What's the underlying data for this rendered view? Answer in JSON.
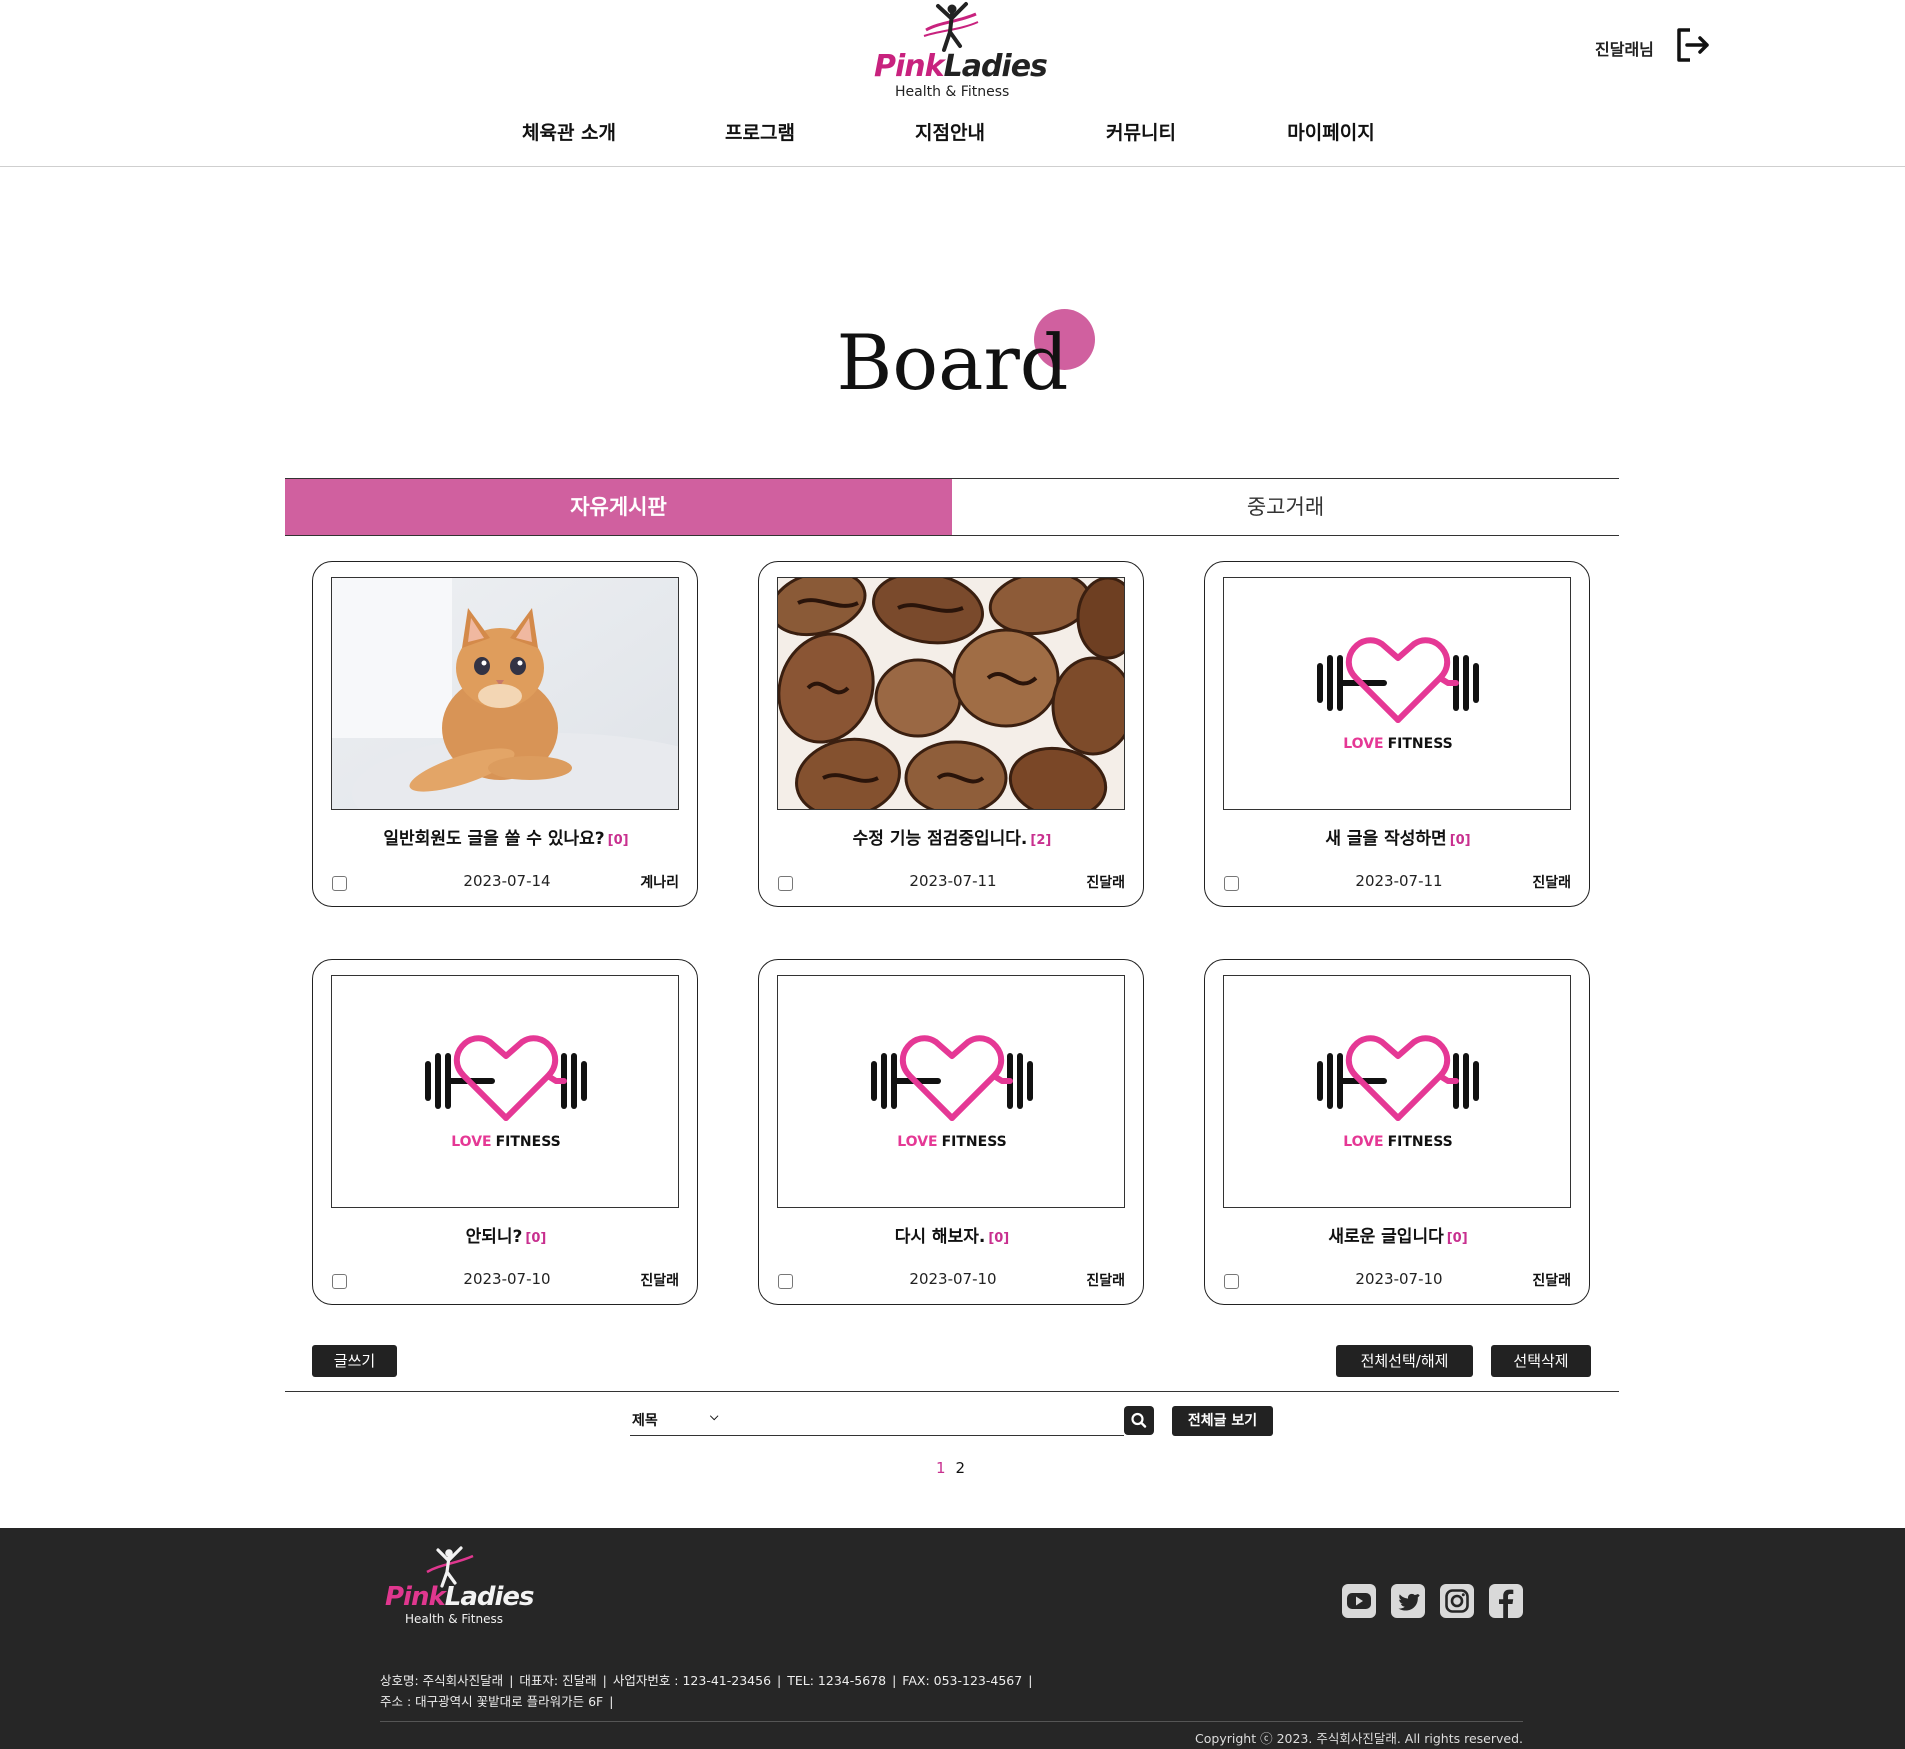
{
  "header": {
    "logo": {
      "word_pink": "Pink",
      "word_dark": "Ladies",
      "sub": "Health & Fitness"
    },
    "user_label": "진달래님",
    "nav": [
      "체육관 소개",
      "프로그램",
      "지점안내",
      "커뮤니티",
      "마이페이지"
    ]
  },
  "page_title": "Board",
  "tabs": {
    "active": "자유게시판",
    "inactive": "중고거래"
  },
  "thumb_logo": {
    "word_pink": "LOVE",
    "word_dark": "FITNESS"
  },
  "posts": [
    {
      "title": "일반회원도 글을 쓸 수 있나요?",
      "count": "[0]",
      "date": "2023-07-14",
      "author": "계나리",
      "image": "kitten-photo"
    },
    {
      "title": "수정 기능 점검중입니다.",
      "count": "[2]",
      "date": "2023-07-11",
      "author": "진달래",
      "image": "coffee-beans-photo"
    },
    {
      "title": "새 글을 작성하면",
      "count": "[0]",
      "date": "2023-07-11",
      "author": "진달래",
      "image": "love-fitness-logo"
    },
    {
      "title": "안되니?",
      "count": "[0]",
      "date": "2023-07-10",
      "author": "진달래",
      "image": "love-fitness-logo"
    },
    {
      "title": "다시 해보자.",
      "count": "[0]",
      "date": "2023-07-10",
      "author": "진달래",
      "image": "love-fitness-logo"
    },
    {
      "title": "새로운 글입니다",
      "count": "[0]",
      "date": "2023-07-10",
      "author": "진달래",
      "image": "love-fitness-logo"
    }
  ],
  "actions": {
    "write": "글쓰기",
    "select_all": "전체선택/해제",
    "delete_selected": "선택삭제"
  },
  "search": {
    "field_selected": "제목",
    "value": "",
    "all_posts": "전체글 보기"
  },
  "pagination": {
    "pages": [
      "1",
      "2"
    ],
    "current": "1"
  },
  "footer": {
    "logo": {
      "word_pink": "Pink",
      "word_light": "Ladies",
      "sub": "Health & Fitness"
    },
    "info_line1": [
      "상호명: 주식회사진달래",
      "대표자: 진달래",
      "사업자번호 : 123-41-23456",
      "TEL: 1234-5678",
      "FAX: 053-123-4567"
    ],
    "info_line2": [
      "주소 : 대구광역시 꽃밭대로 플라워가든 6F"
    ],
    "copyright": "Copyright ⓒ 2023. 주식회사진달래. All rights reserved.",
    "social": [
      "youtube-icon",
      "twitter-icon",
      "instagram-icon",
      "facebook-icon"
    ]
  },
  "colors": {
    "brand_pink": "#d0609f",
    "accent_pink": "#c8308f",
    "dark": "#222222",
    "footer_bg": "#262626"
  }
}
